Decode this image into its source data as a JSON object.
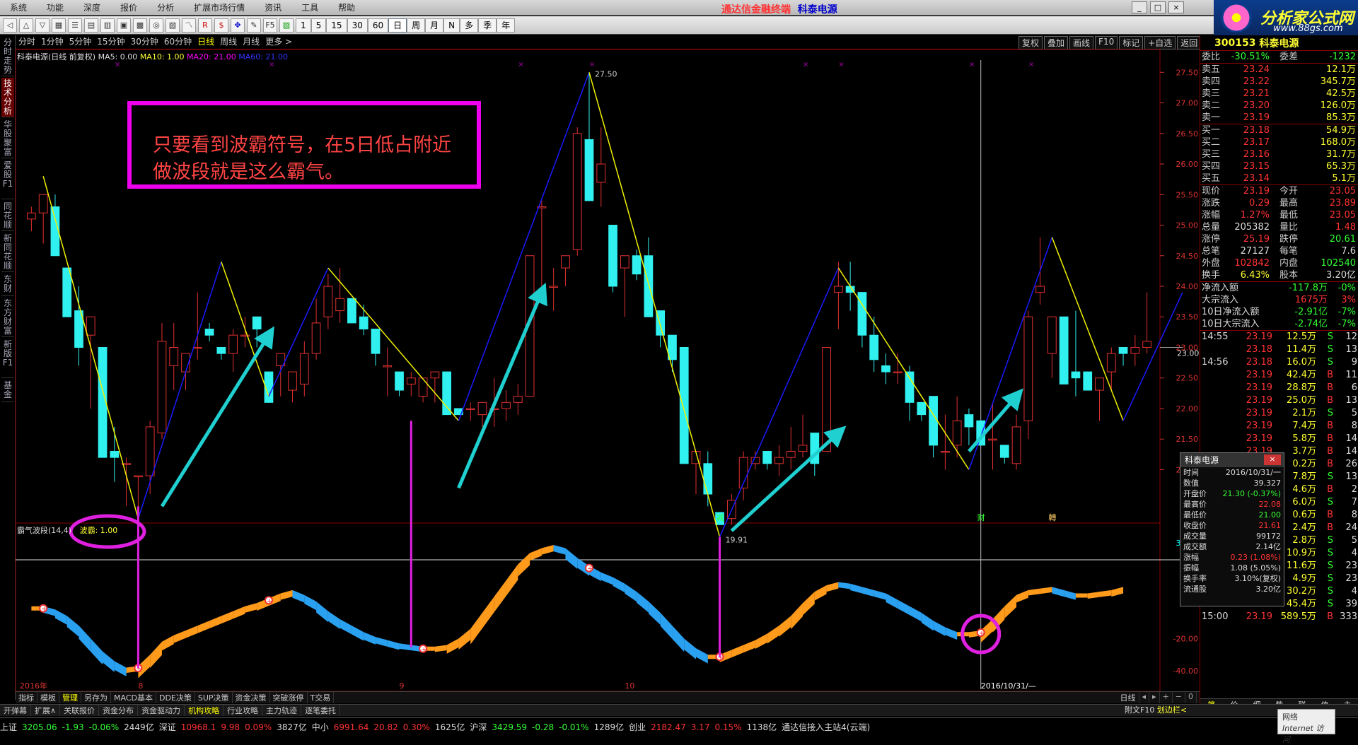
{
  "menu": [
    "系统",
    "功能",
    "深度",
    "报价",
    "分析",
    "扩展市场行情",
    "资讯",
    "工具",
    "帮助"
  ],
  "app_title": {
    "left": "通达信金融终端",
    "right": "科泰电源"
  },
  "window_buttons": [
    "_",
    "□",
    "×"
  ],
  "toolbar_periods": [
    "1",
    "5",
    "15",
    "30",
    "60",
    "日",
    "周",
    "月",
    "N",
    "多",
    "季",
    "年"
  ],
  "toolbar_active_period": "日",
  "logo": {
    "title": "分析家公式网",
    "url": "www.88gs.com"
  },
  "left_tabs": [
    "分时走势",
    "技术分析",
    "华股聚富",
    "爱股F1",
    "同花顺",
    "新同花顺",
    "东财",
    "东方财富",
    "新版F1",
    "基金"
  ],
  "period_bar": [
    "分时",
    "1分钟",
    "5分钟",
    "15分钟",
    "30分钟",
    "60分钟",
    "日线",
    "周线",
    "月线",
    "更多 >"
  ],
  "period_active": "日线",
  "right_tools": [
    "复权",
    "叠加",
    "画线",
    "F10",
    "标记",
    "+自选",
    "返回"
  ],
  "legend": {
    "stock": "科泰电源(日线 前复权)",
    "ma5": "MA5: 0.00",
    "ma10": "MA10: 1.00",
    "ma20": "MA20: 21.00",
    "ma60": "MA60: 21.00"
  },
  "indicator_legend": {
    "name": "霸气波段(14,4)",
    "value": "波霸: 1.00"
  },
  "annotation": {
    "line1": "只要看到波霸符号，在5日低占附近",
    "line2": "做波段就是这么霸气。"
  },
  "price_axis": [
    "27.50",
    "27.00",
    "26.50",
    "26.00",
    "25.50",
    "25.00",
    "24.50",
    "24.00",
    "23.50",
    "23.00",
    "22.50",
    "22.00",
    "21.50",
    "21.00"
  ],
  "indicator_axis": [
    "39.33",
    "-20.00",
    "-40.00"
  ],
  "x_labels": [
    "2016年",
    "8",
    "9",
    "10",
    "2016/10/31/—"
  ],
  "high_label": "27.50",
  "low_label": "19.91",
  "price_marker": "23.00 - 23.05",
  "event_marks": [
    "减",
    "财",
    "轉"
  ],
  "chart_data": {
    "type": "candlestick",
    "ylim": [
      20.3,
      27.7
    ],
    "candles": [
      [
        25.1,
        25.3,
        24.9,
        25.2
      ],
      [
        25.2,
        25.5,
        24.7,
        25.5
      ],
      [
        25.3,
        25.5,
        24.5,
        24.5
      ],
      [
        24.3,
        24.3,
        23.5,
        23.5
      ],
      [
        23.6,
        24.0,
        22.7,
        23.0
      ],
      [
        23.2,
        23.2,
        22.0,
        23.5
      ],
      [
        23.0,
        23.0,
        21.2,
        21.2
      ],
      [
        21.3,
        21.7,
        20.8,
        21.2
      ],
      [
        21.1,
        21.2,
        20.4,
        21.1
      ],
      [
        20.9,
        20.9,
        20.1,
        20.9
      ],
      [
        20.9,
        21.8,
        20.6,
        21.7
      ],
      [
        21.6,
        23.4,
        21.5,
        23.1
      ],
      [
        22.7,
        23.4,
        22.3,
        23.0
      ],
      [
        22.6,
        22.6,
        22.3,
        22.9
      ],
      [
        23.0,
        23.9,
        22.8,
        23.0
      ],
      [
        23.3,
        23.4,
        23.1,
        23.2
      ],
      [
        23.0,
        23.0,
        22.8,
        22.9
      ],
      [
        22.9,
        23.3,
        22.6,
        23.2
      ],
      [
        23.2,
        23.5,
        23.0,
        23.2
      ],
      [
        23.5,
        23.5,
        23.0,
        23.3
      ],
      [
        22.6,
        22.6,
        22.1,
        22.1
      ],
      [
        22.7,
        22.8,
        22.2,
        22.9
      ],
      [
        22.3,
        22.3,
        22.1,
        22.6
      ],
      [
        22.4,
        23.1,
        22.2,
        22.9
      ],
      [
        22.9,
        23.8,
        22.8,
        23.4
      ],
      [
        23.5,
        24.2,
        23.3,
        24.0
      ],
      [
        23.6,
        24.3,
        23.4,
        23.8
      ],
      [
        23.8,
        23.8,
        23.5,
        23.4
      ],
      [
        23.5,
        23.7,
        23.2,
        23.3
      ],
      [
        23.3,
        23.3,
        22.7,
        22.9
      ],
      [
        22.7,
        23.0,
        22.2,
        22.7
      ],
      [
        22.6,
        22.6,
        22.2,
        22.3
      ],
      [
        22.4,
        22.6,
        22.2,
        22.5
      ],
      [
        22.2,
        22.3,
        22.1,
        22.5
      ],
      [
        22.5,
        22.5,
        22.1,
        22.6
      ],
      [
        22.6,
        22.6,
        21.9,
        21.9
      ],
      [
        22.0,
        22.0,
        21.9,
        21.9
      ],
      [
        22.0,
        22.1,
        21.8,
        22.0
      ],
      [
        21.9,
        22.1,
        21.7,
        22.1
      ],
      [
        22.0,
        22.5,
        21.7,
        22.0
      ],
      [
        22.0,
        22.3,
        21.8,
        22.1
      ],
      [
        22.1,
        22.4,
        21.9,
        22.2
      ],
      [
        22.2,
        24.5,
        22.2,
        24.5
      ],
      [
        25.3,
        25.4,
        24.0,
        25.3
      ],
      [
        24.0,
        24.3,
        23.6,
        24.0
      ],
      [
        24.3,
        24.3,
        24.0,
        24.5
      ],
      [
        24.6,
        26.6,
        24.5,
        26.5
      ],
      [
        26.4,
        27.5,
        25.6,
        25.4
      ],
      [
        25.7,
        26.6,
        25.3,
        26.0
      ],
      [
        25.0,
        25.0,
        23.9,
        24.0
      ],
      [
        24.3,
        24.4,
        23.5,
        24.5
      ],
      [
        24.5,
        24.6,
        24.1,
        24.2
      ],
      [
        24.5,
        24.8,
        23.7,
        23.5
      ],
      [
        23.6,
        23.6,
        23.0,
        23.2
      ],
      [
        23.2,
        23.2,
        22.6,
        22.8
      ],
      [
        23.0,
        23.0,
        21.1,
        21.1
      ],
      [
        21.1,
        21.2,
        20.6,
        21.3
      ],
      [
        21.1,
        21.3,
        20.4,
        20.6
      ],
      [
        20.3,
        20.3,
        20.1,
        20.1
      ],
      [
        20.2,
        20.6,
        20.1,
        20.5
      ],
      [
        20.7,
        21.3,
        20.5,
        21.2
      ],
      [
        21.1,
        21.3,
        21.0,
        21.2
      ],
      [
        21.3,
        21.3,
        21.0,
        21.1
      ],
      [
        21.1,
        21.4,
        20.9,
        21.2
      ],
      [
        21.2,
        21.7,
        21.0,
        21.3
      ],
      [
        21.3,
        21.9,
        21.2,
        21.4
      ],
      [
        21.6,
        21.6,
        20.9,
        21.1
      ],
      [
        21.3,
        23.0,
        21.3,
        23.0
      ],
      [
        23.9,
        24.4,
        23.3,
        24.0
      ],
      [
        24.0,
        24.4,
        23.6,
        23.9
      ],
      [
        23.9,
        23.9,
        23.0,
        23.2
      ],
      [
        23.2,
        23.5,
        22.6,
        22.8
      ],
      [
        22.7,
        22.9,
        22.4,
        22.6
      ],
      [
        22.6,
        22.9,
        22.4,
        22.6
      ],
      [
        22.6,
        22.7,
        21.8,
        22.1
      ],
      [
        22.1,
        22.1,
        21.8,
        21.9
      ],
      [
        22.2,
        22.2,
        21.2,
        21.4
      ],
      [
        21.3,
        21.9,
        21.0,
        21.3
      ],
      [
        21.4,
        22.2,
        21.2,
        21.8
      ],
      [
        21.9,
        22.0,
        21.4,
        21.7
      ],
      [
        21.8,
        21.8,
        21.4,
        21.4
      ],
      [
        21.5,
        22.1,
        21.0,
        21.5
      ],
      [
        21.4,
        21.4,
        21.1,
        21.2
      ],
      [
        21.1,
        21.9,
        21.0,
        21.7
      ],
      [
        21.8,
        23.6,
        21.5,
        23.5
      ],
      [
        23.9,
        24.8,
        23.7,
        24.0
      ],
      [
        22.9,
        23.0,
        22.5,
        23.5
      ],
      [
        23.5,
        23.5,
        22.9,
        22.4
      ],
      [
        22.6,
        23.6,
        22.2,
        22.5
      ],
      [
        22.6,
        22.6,
        22.3,
        22.3
      ],
      [
        22.3,
        22.5,
        21.8,
        22.5
      ],
      [
        22.6,
        23.0,
        22.3,
        22.9
      ],
      [
        23.0,
        23.0,
        22.7,
        22.9
      ],
      [
        22.9,
        23.2,
        22.7,
        23.0
      ],
      [
        23.0,
        23.9,
        22.9,
        23.1
      ]
    ],
    "wave_points": [
      [
        1,
        25.8
      ],
      [
        9,
        20.2
      ],
      [
        16,
        24.4
      ],
      [
        20,
        22.2
      ],
      [
        25,
        24.3
      ],
      [
        36,
        21.8
      ],
      [
        47,
        27.5
      ],
      [
        58,
        19.9
      ],
      [
        68,
        24.3
      ],
      [
        79,
        21.0
      ],
      [
        86,
        24.8
      ],
      [
        92,
        21.8
      ],
      [
        97,
        23.9
      ]
    ],
    "arrows": [
      [
        11,
        20.4,
        20,
        23.2
      ],
      [
        36,
        20.7,
        43,
        23.9
      ],
      [
        59,
        20.0,
        68,
        21.6
      ],
      [
        79,
        21.3,
        83,
        22.2
      ]
    ],
    "indicator": {
      "ylim": [
        -47,
        45
      ],
      "values": [
        0,
        0,
        -2,
        -6,
        -12,
        -20,
        -28,
        -34,
        -38,
        -37,
        -30,
        -22,
        -18,
        -15,
        -12,
        -9,
        -6,
        -3,
        0,
        2,
        5,
        8,
        10,
        7,
        3,
        -3,
        -8,
        -12,
        -16,
        -19,
        -21,
        -23,
        -24,
        -25,
        -25,
        -24,
        -20,
        -14,
        -4,
        6,
        16,
        26,
        33,
        36,
        38,
        36,
        30,
        25,
        21,
        18,
        14,
        9,
        3,
        -4,
        -12,
        -20,
        -26,
        -30,
        -30,
        -27,
        -24,
        -21,
        -17,
        -12,
        -6,
        2,
        9,
        13,
        15,
        14,
        12,
        10,
        8,
        4,
        0,
        -4,
        -9,
        -13,
        -16,
        -16,
        -15,
        -8,
        0,
        7,
        10,
        11,
        12,
        10,
        8,
        8,
        9,
        10,
        12
      ]
    },
    "indicator_marks": [
      1,
      9,
      20,
      33,
      47,
      58,
      80
    ],
    "vlines_price": [
      9,
      32,
      58,
      79
    ]
  },
  "quote": {
    "code": "300153",
    "name": "科泰电源",
    "weibi": {
      "label": "委比",
      "value": "-30.51%",
      "label2": "委差",
      "value2": "-1232"
    },
    "sell": [
      {
        "label": "卖五",
        "price": "23.24",
        "vol": "12.1万"
      },
      {
        "label": "卖四",
        "price": "23.22",
        "vol": "345.7万"
      },
      {
        "label": "卖三",
        "price": "23.21",
        "vol": "42.5万"
      },
      {
        "label": "卖二",
        "price": "23.20",
        "vol": "126.0万"
      },
      {
        "label": "卖一",
        "price": "23.19",
        "vol": "85.3万"
      }
    ],
    "buy": [
      {
        "label": "买一",
        "price": "23.18",
        "vol": "54.9万"
      },
      {
        "label": "买二",
        "price": "23.17",
        "vol": "168.0万"
      },
      {
        "label": "买三",
        "price": "23.16",
        "vol": "31.7万"
      },
      {
        "label": "买四",
        "price": "23.15",
        "vol": "65.3万"
      },
      {
        "label": "买五",
        "price": "23.14",
        "vol": "5.1万"
      }
    ],
    "stats": [
      {
        "k1": "现价",
        "v1": "23.19",
        "k2": "今开",
        "v2": "23.05",
        "c1": "red",
        "c2": "red"
      },
      {
        "k1": "涨跌",
        "v1": "0.29",
        "k2": "最高",
        "v2": "23.89",
        "c1": "red",
        "c2": "red"
      },
      {
        "k1": "涨幅",
        "v1": "1.27%",
        "k2": "最低",
        "v2": "23.05",
        "c1": "red",
        "c2": "red"
      },
      {
        "k1": "总量",
        "v1": "205382",
        "k2": "量比",
        "v2": "1.48",
        "c1": "white",
        "c2": "red"
      },
      {
        "k1": "涨停",
        "v1": "25.19",
        "k2": "跌停",
        "v2": "20.61",
        "c1": "red",
        "c2": "green"
      },
      {
        "k1": "总笔",
        "v1": "27127",
        "k2": "每笔",
        "v2": "7.6",
        "c1": "white",
        "c2": "white"
      },
      {
        "k1": "外盘",
        "v1": "102842",
        "k2": "内盘",
        "v2": "102540",
        "c1": "red",
        "c2": "green"
      },
      {
        "k1": "换手",
        "v1": "6.43%",
        "k2": "股本",
        "v2": "3.20亿",
        "c1": "yel",
        "c2": "white"
      }
    ],
    "flows": [
      {
        "k": "净流入额",
        "v": "-117.8万",
        "p": "-0%",
        "c": "green"
      },
      {
        "k": "大宗流入",
        "v": "1675万",
        "p": "3%",
        "c": "red"
      },
      {
        "k": "10日净流入额",
        "v": "-2.91亿",
        "p": "-7%",
        "c": "green"
      },
      {
        "k": "10日大宗流入",
        "v": "-2.74亿",
        "p": "-7%",
        "c": "green"
      }
    ],
    "ticks": [
      {
        "t": "14:55",
        "p": "23.19",
        "v": "12.5万",
        "s": "S",
        "n": "12"
      },
      {
        "t": "",
        "p": "23.18",
        "v": "11.4万",
        "s": "S",
        "n": "13"
      },
      {
        "t": "14:56",
        "p": "23.18",
        "v": "16.0万",
        "s": "S",
        "n": "9"
      },
      {
        "t": "",
        "p": "23.19",
        "v": "42.4万",
        "s": "B",
        "n": "11"
      },
      {
        "t": "",
        "p": "23.19",
        "v": "28.8万",
        "s": "B",
        "n": "6"
      },
      {
        "t": "",
        "p": "23.19",
        "v": "25.0万",
        "s": "B",
        "n": "13"
      },
      {
        "t": "",
        "p": "23.19",
        "v": "2.1万",
        "s": "S",
        "n": "5"
      },
      {
        "t": "",
        "p": "23.19",
        "v": "7.4万",
        "s": "B",
        "n": "8"
      },
      {
        "t": "",
        "p": "23.19",
        "v": "5.8万",
        "s": "B",
        "n": "14"
      },
      {
        "t": "",
        "p": "23.19",
        "v": "3.7万",
        "s": "B",
        "n": "14"
      },
      {
        "t": "",
        "p": "23.19",
        "v": "0.2万",
        "s": "B",
        "n": "26"
      },
      {
        "t": "",
        "p": "23.19",
        "v": "7.8万",
        "s": "S",
        "n": "13"
      },
      {
        "t": "",
        "p": "23.19",
        "v": "4.6万",
        "s": "B",
        "n": "2"
      },
      {
        "t": "",
        "p": "23.19",
        "v": "6.0万",
        "s": "S",
        "n": "7"
      },
      {
        "t": "",
        "p": "23.19",
        "v": "0.6万",
        "s": "B",
        "n": "8"
      },
      {
        "t": "",
        "p": "23.19",
        "v": "2.4万",
        "s": "B",
        "n": "24"
      },
      {
        "t": "",
        "p": "23.19",
        "v": "2.8万",
        "s": "S",
        "n": "5"
      },
      {
        "t": "",
        "p": "23.19",
        "v": "10.9万",
        "s": "S",
        "n": "4"
      },
      {
        "t": "",
        "p": "23.19",
        "v": "11.6万",
        "s": "S",
        "n": "23"
      },
      {
        "t": "",
        "p": "23.19",
        "v": "4.9万",
        "s": "S",
        "n": "23"
      },
      {
        "t": "14:57",
        "p": "23.18",
        "v": "30.2万",
        "s": "S",
        "n": "4"
      },
      {
        "t": "",
        "p": "23.17",
        "v": "45.4万",
        "s": "S",
        "n": "39"
      },
      {
        "t": "15:00",
        "p": "23.19",
        "v": "589.5万",
        "s": "B",
        "n": "333"
      }
    ],
    "bottom_tabs": [
      "笔",
      "价",
      "细",
      "势",
      "联",
      "值",
      "主"
    ]
  },
  "infobox": {
    "title": "科泰电源",
    "close": "×",
    "rows": [
      {
        "k": "时间",
        "v": "2016/10/31/一",
        "c": "white"
      },
      {
        "k": "数值",
        "v": "39.327",
        "c": "white"
      },
      {
        "k": "开盘价",
        "v": "21.30 (-0.37%)",
        "c": "green"
      },
      {
        "k": "最高价",
        "v": "22.08",
        "c": "red"
      },
      {
        "k": "最低价",
        "v": "21.00",
        "c": "green"
      },
      {
        "k": "收盘价",
        "v": "21.61",
        "c": "red"
      },
      {
        "k": "成交量",
        "v": "99172",
        "c": "white"
      },
      {
        "k": "成交额",
        "v": "2.14亿",
        "c": "white"
      },
      {
        "k": "涨幅",
        "v": "0.23 (1.08%)",
        "c": "red"
      },
      {
        "k": "振幅",
        "v": "1.08 (5.05%)",
        "c": "white"
      },
      {
        "k": "换手率",
        "v": "3.10%(复权)",
        "c": "white"
      },
      {
        "k": "流通股",
        "v": "3.20亿",
        "c": "white"
      }
    ]
  },
  "bottom_tabs": [
    "指标",
    "模板",
    "管理",
    "另存为",
    "MACD基本",
    "DDE决策",
    "SUP决策",
    "资金决策",
    "突破涨停",
    "T交易"
  ],
  "bottom_tabs_active": "管理",
  "bottom_tabs2": [
    "开弹幕",
    "扩展∧",
    "关联报价",
    "资金分布",
    "资金驱动力",
    "机构攻略",
    "行业攻略",
    "主力轨迹",
    "逐笔委托"
  ],
  "bottom_right": [
    "日线",
    "◂",
    "▸",
    "+",
    "−",
    "0"
  ],
  "f10_label": "附文F10",
  "zoom_label": "划边栏<",
  "status": [
    {
      "t": "上证",
      "c": "white"
    },
    {
      "t": "3205.06",
      "c": "green"
    },
    {
      "t": "-1.93",
      "c": "green"
    },
    {
      "t": "-0.06%",
      "c": "green"
    },
    {
      "t": "2449亿",
      "c": "white"
    },
    {
      "t": "深证",
      "c": "white"
    },
    {
      "t": "10968.1",
      "c": "red"
    },
    {
      "t": "9.98",
      "c": "red"
    },
    {
      "t": "0.09%",
      "c": "red"
    },
    {
      "t": "3827亿",
      "c": "white"
    },
    {
      "t": "中小",
      "c": "white"
    },
    {
      "t": "6991.64",
      "c": "red"
    },
    {
      "t": "20.82",
      "c": "red"
    },
    {
      "t": "0.30%",
      "c": "red"
    },
    {
      "t": "1625亿",
      "c": "white"
    },
    {
      "t": "沪深",
      "c": "white"
    },
    {
      "t": "3429.59",
      "c": "green"
    },
    {
      "t": "-0.28",
      "c": "green"
    },
    {
      "t": "-0.01%",
      "c": "green"
    },
    {
      "t": "1289亿",
      "c": "white"
    },
    {
      "t": "创业",
      "c": "white"
    },
    {
      "t": "2182.47",
      "c": "red"
    },
    {
      "t": "3.17",
      "c": "red"
    },
    {
      "t": "0.15%",
      "c": "red"
    },
    {
      "t": "1138亿",
      "c": "white"
    },
    {
      "t": "通达信接入主站4(云端)",
      "c": "white"
    }
  ],
  "net": {
    "l1": "网络",
    "l2": "Internet 访问"
  },
  "colors": {
    "up": "#e03030",
    "down": "#30f0f0",
    "wave_up": "#1a1aff",
    "wave_down": "#f0f000",
    "arrow": "#20d0d0",
    "ind_up": "#ff9a1a",
    "ind_down": "#2aa0f0",
    "magenta": "#e020e0"
  }
}
